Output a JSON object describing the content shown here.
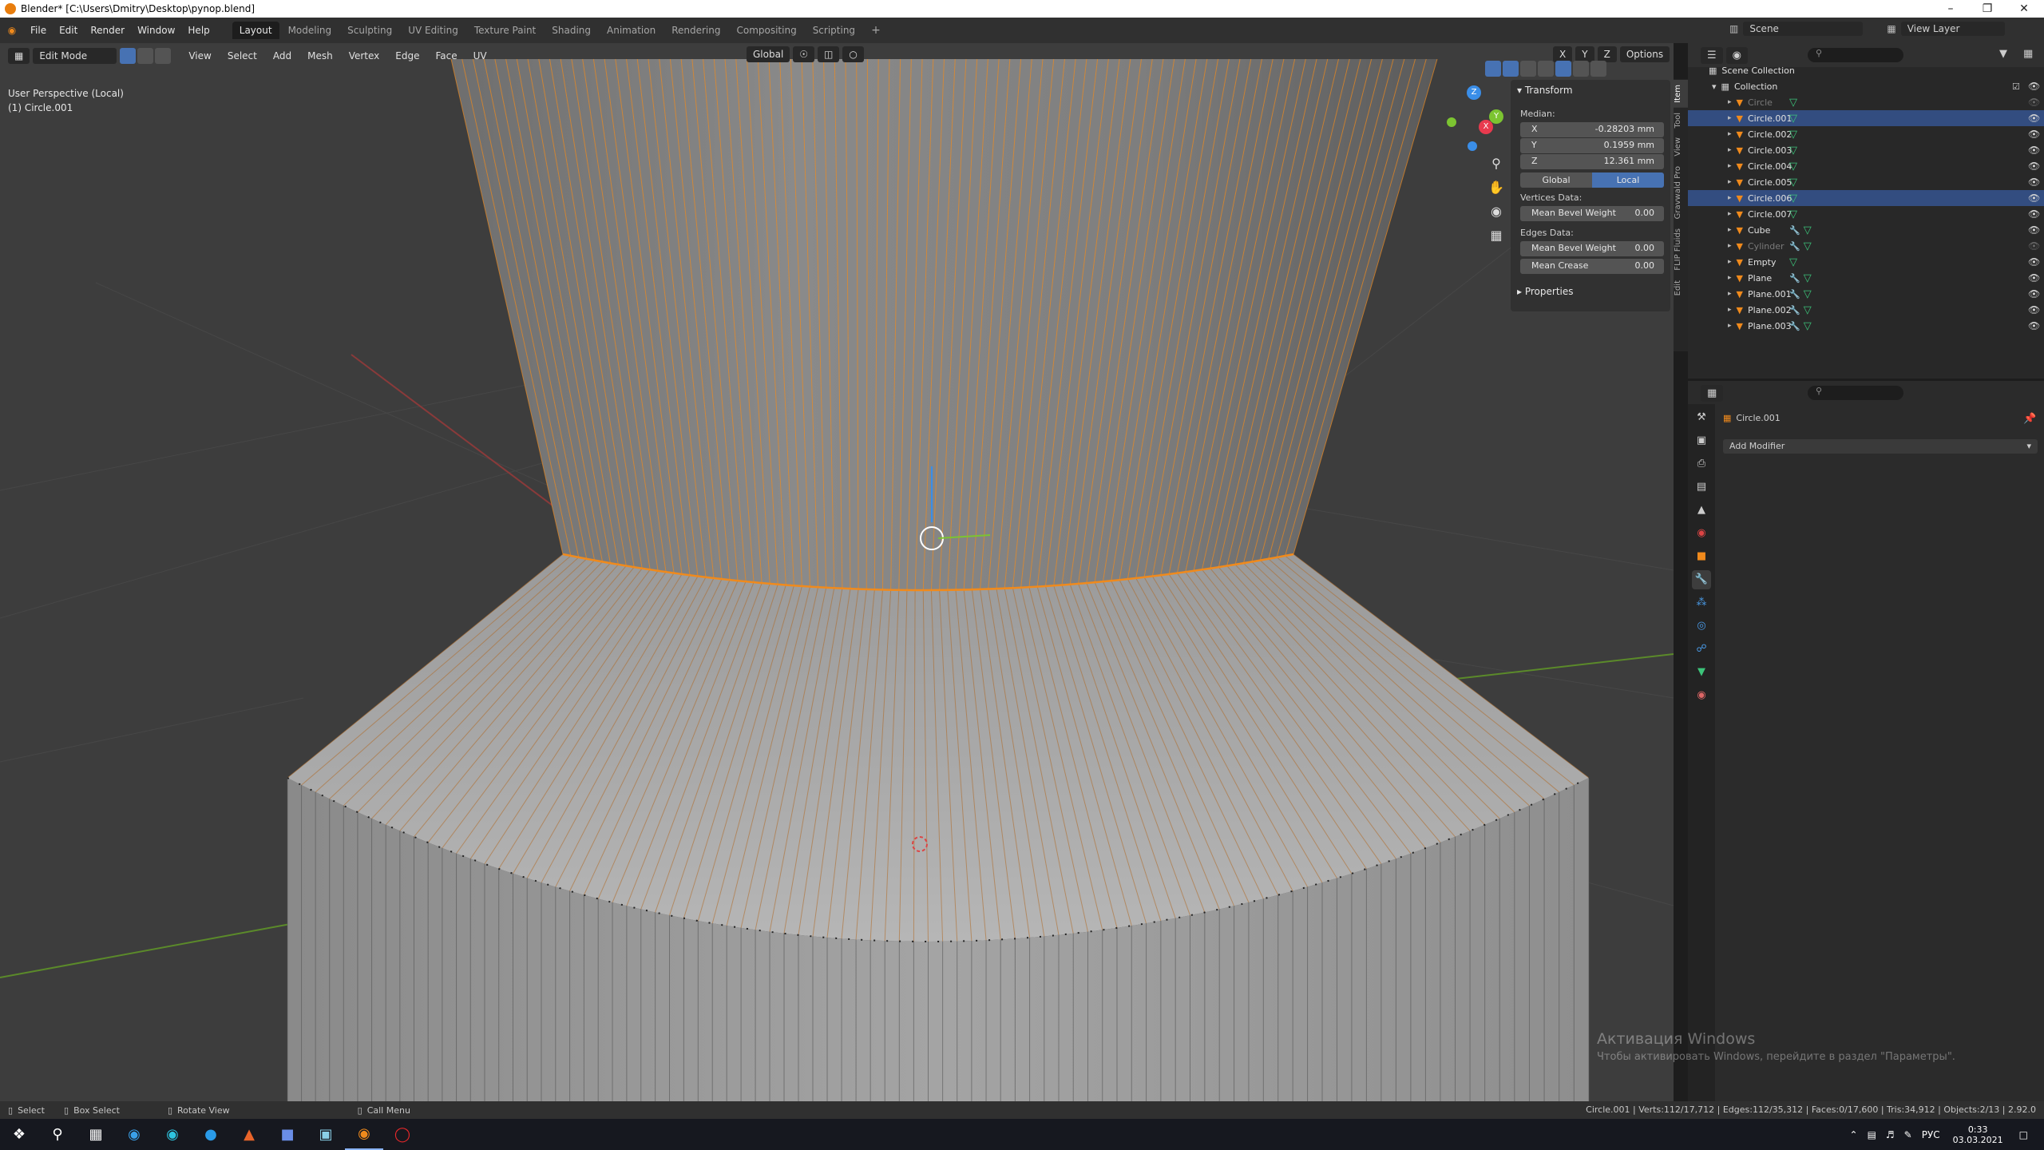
{
  "window": {
    "title": "Blender* [C:\\Users\\Dmitry\\Desktop\\pynop.blend]"
  },
  "menu": [
    "File",
    "Edit",
    "Render",
    "Window",
    "Help"
  ],
  "workspaces": [
    "Layout",
    "Modeling",
    "Sculpting",
    "UV Editing",
    "Texture Paint",
    "Shading",
    "Animation",
    "Rendering",
    "Compositing",
    "Scripting"
  ],
  "active_workspace": "Layout",
  "topbar_right": {
    "scene": "Scene",
    "view_layer": "View Layer"
  },
  "viewport_header": {
    "mode": "Edit Mode",
    "menus": [
      "View",
      "Select",
      "Add",
      "Mesh",
      "Vertex",
      "Edge",
      "Face",
      "UV"
    ],
    "transform_orientation": "Global",
    "options": "Options",
    "axes": [
      "X",
      "Y",
      "Z"
    ]
  },
  "viewport_overlay": {
    "perspective": "User Perspective (Local)",
    "object": "(1) Circle.001"
  },
  "gizmo": {
    "x": "X",
    "y": "Y",
    "z": "Z"
  },
  "npanel": {
    "transform_title": "Transform",
    "median_label": "Median:",
    "median": [
      {
        "axis": "X",
        "value": "-0.28203 mm"
      },
      {
        "axis": "Y",
        "value": "0.1959 mm"
      },
      {
        "axis": "Z",
        "value": "12.361 mm"
      }
    ],
    "space_global": "Global",
    "space_local": "Local",
    "vertices_data": "Vertices Data:",
    "mean_bevel_weight_v": {
      "label": "Mean Bevel Weight",
      "value": "0.00"
    },
    "edges_data": "Edges Data:",
    "mean_bevel_weight_e": {
      "label": "Mean Bevel Weight",
      "value": "0.00"
    },
    "mean_crease": {
      "label": "Mean Crease",
      "value": "0.00"
    },
    "properties_title": "Properties",
    "tabs": [
      "Item",
      "Tool",
      "View",
      "Gravwald Pro",
      "FLIP Fluids",
      "Edit"
    ]
  },
  "outliner": {
    "root": "Scene Collection",
    "collection": "Collection",
    "items": [
      {
        "name": "Circle",
        "hidden": true,
        "selected": false,
        "modifier": false
      },
      {
        "name": "Circle.001",
        "hidden": false,
        "selected": true,
        "modifier": false
      },
      {
        "name": "Circle.002",
        "hidden": false,
        "selected": false,
        "modifier": false
      },
      {
        "name": "Circle.003",
        "hidden": false,
        "selected": false,
        "modifier": false
      },
      {
        "name": "Circle.004",
        "hidden": false,
        "selected": false,
        "modifier": false
      },
      {
        "name": "Circle.005",
        "hidden": false,
        "selected": false,
        "modifier": false
      },
      {
        "name": "Circle.006",
        "hidden": false,
        "selected": true,
        "modifier": false
      },
      {
        "name": "Circle.007",
        "hidden": false,
        "selected": false,
        "modifier": false
      },
      {
        "name": "Cube",
        "hidden": false,
        "selected": false,
        "modifier": true
      },
      {
        "name": "Cylinder",
        "hidden": true,
        "selected": false,
        "modifier": true
      },
      {
        "name": "Empty",
        "hidden": false,
        "selected": false,
        "modifier": false
      },
      {
        "name": "Plane",
        "hidden": false,
        "selected": false,
        "modifier": true
      },
      {
        "name": "Plane.001",
        "hidden": false,
        "selected": false,
        "modifier": true
      },
      {
        "name": "Plane.002",
        "hidden": false,
        "selected": false,
        "modifier": true
      },
      {
        "name": "Plane.003",
        "hidden": false,
        "selected": false,
        "modifier": true
      }
    ]
  },
  "properties": {
    "object": "Circle.001",
    "add_modifier": "Add Modifier"
  },
  "statusbar": {
    "select": "Select",
    "box_select": "Box Select",
    "rotate": "Rotate View",
    "call_menu": "Call Menu",
    "stats": "Circle.001 | Verts:112/17,712 | Edges:112/35,312 | Faces:0/17,600 | Tris:34,912 | Objects:2/13 | 2.92.0"
  },
  "watermark": {
    "line1": "Активация Windows",
    "line2": "Чтобы активировать Windows, перейдите в раздел \"Параметры\"."
  },
  "taskbar": {
    "lang": "РУС",
    "time": "0:33",
    "date": "03.03.2021"
  },
  "colors": {
    "accent": "#4772b3",
    "orange": "#f08a1c",
    "selected_row": "#334d80"
  }
}
